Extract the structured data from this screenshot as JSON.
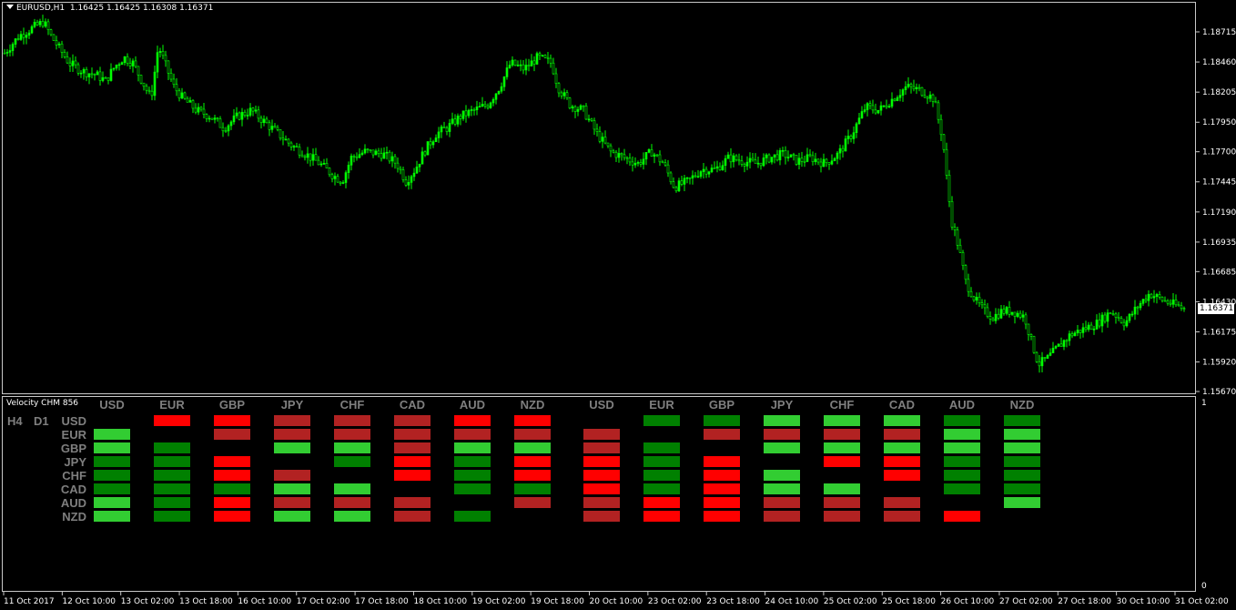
{
  "chart": {
    "symbol": "EURUSD,H1",
    "ohlc": "1.16425 1.16425 1.16308 1.16371",
    "current_price": "1.16371",
    "colors": {
      "background": "#000000",
      "candle": "#00ff00",
      "frame": "#c8c8c8",
      "text": "#ffffff"
    },
    "price_scale": [
      "1.18715",
      "1.18460",
      "1.18205",
      "1.17950",
      "1.17700",
      "1.17445",
      "1.17190",
      "1.16935",
      "1.16685",
      "1.16430",
      "1.16175",
      "1.15920",
      "1.15670"
    ],
    "time_scale": [
      "11 Oct 2017",
      "12 Oct 10:00",
      "13 Oct 02:00",
      "13 Oct 18:00",
      "16 Oct 10:00",
      "17 Oct 02:00",
      "17 Oct 18:00",
      "18 Oct 10:00",
      "19 Oct 02:00",
      "19 Oct 18:00",
      "20 Oct 10:00",
      "23 Oct 02:00",
      "23 Oct 18:00",
      "24 Oct 10:00",
      "25 Oct 02:00",
      "25 Oct 18:00",
      "26 Oct 10:00",
      "27 Oct 02:00",
      "27 Oct 18:00",
      "30 Oct 10:00",
      "31 Oct 02:00"
    ],
    "close_path": [
      [
        0,
        1.185
      ],
      [
        20,
        1.1868
      ],
      [
        35,
        1.1875
      ],
      [
        47,
        1.188
      ],
      [
        55,
        1.1868
      ],
      [
        75,
        1.1845
      ],
      [
        90,
        1.1838
      ],
      [
        105,
        1.1835
      ],
      [
        115,
        1.183
      ],
      [
        125,
        1.1842
      ],
      [
        135,
        1.185
      ],
      [
        145,
        1.1845
      ],
      [
        155,
        1.183
      ],
      [
        165,
        1.1815
      ],
      [
        173,
        1.186
      ],
      [
        180,
        1.1845
      ],
      [
        190,
        1.1825
      ],
      [
        200,
        1.1815
      ],
      [
        215,
        1.1805
      ],
      [
        230,
        1.18
      ],
      [
        245,
        1.179
      ],
      [
        260,
        1.18
      ],
      [
        275,
        1.1805
      ],
      [
        290,
        1.1795
      ],
      [
        305,
        1.1785
      ],
      [
        320,
        1.1775
      ],
      [
        335,
        1.1768
      ],
      [
        350,
        1.176
      ],
      [
        365,
        1.175
      ],
      [
        375,
        1.1745
      ],
      [
        385,
        1.1765
      ],
      [
        400,
        1.177
      ],
      [
        420,
        1.1768
      ],
      [
        435,
        1.176
      ],
      [
        445,
        1.1745
      ],
      [
        455,
        1.1755
      ],
      [
        465,
        1.177
      ],
      [
        478,
        1.1785
      ],
      [
        490,
        1.179
      ],
      [
        505,
        1.18
      ],
      [
        520,
        1.1805
      ],
      [
        535,
        1.181
      ],
      [
        548,
        1.1825
      ],
      [
        560,
        1.1845
      ],
      [
        575,
        1.184
      ],
      [
        590,
        1.185
      ],
      [
        605,
        1.1845
      ],
      [
        612,
        1.1825
      ],
      [
        625,
        1.181
      ],
      [
        640,
        1.1805
      ],
      [
        655,
        1.1785
      ],
      [
        670,
        1.177
      ],
      [
        685,
        1.1765
      ],
      [
        700,
        1.176
      ],
      [
        715,
        1.177
      ],
      [
        728,
        1.176
      ],
      [
        740,
        1.174
      ],
      [
        755,
        1.1745
      ],
      [
        770,
        1.1755
      ],
      [
        785,
        1.1755
      ],
      [
        800,
        1.1765
      ],
      [
        815,
        1.1762
      ],
      [
        830,
        1.176
      ],
      [
        845,
        1.1765
      ],
      [
        860,
        1.1768
      ],
      [
        875,
        1.1762
      ],
      [
        890,
        1.1765
      ],
      [
        905,
        1.176
      ],
      [
        920,
        1.1768
      ],
      [
        935,
        1.1785
      ],
      [
        950,
        1.1808
      ],
      [
        965,
        1.1805
      ],
      [
        980,
        1.1815
      ],
      [
        995,
        1.1825
      ],
      [
        1010,
        1.1822
      ],
      [
        1025,
        1.1815
      ],
      [
        1035,
        1.178
      ],
      [
        1040,
        1.174
      ],
      [
        1045,
        1.171
      ],
      [
        1052,
        1.169
      ],
      [
        1060,
        1.166
      ],
      [
        1070,
        1.1645
      ],
      [
        1080,
        1.1635
      ],
      [
        1090,
        1.163
      ],
      [
        1100,
        1.1635
      ],
      [
        1112,
        1.1635
      ],
      [
        1125,
        1.163
      ],
      [
        1132,
        1.161
      ],
      [
        1140,
        1.159
      ],
      [
        1150,
        1.1595
      ],
      [
        1162,
        1.1605
      ],
      [
        1175,
        1.1615
      ],
      [
        1190,
        1.162
      ],
      [
        1205,
        1.1625
      ],
      [
        1220,
        1.1635
      ],
      [
        1235,
        1.1625
      ],
      [
        1250,
        1.164
      ],
      [
        1262,
        1.165
      ],
      [
        1275,
        1.1645
      ],
      [
        1290,
        1.164
      ],
      [
        1300,
        1.1637
      ]
    ]
  },
  "indicator": {
    "name": "Velocity CHM 856",
    "scale_top": "1",
    "scale_bottom": "0",
    "timeframes": [
      "H4",
      "D1"
    ],
    "currencies": [
      "USD",
      "EUR",
      "GBP",
      "JPY",
      "CHF",
      "CAD",
      "AUD",
      "NZD"
    ],
    "colors": {
      "G": "#32cd32",
      "g": "#008000",
      "R": "#ff0000",
      "r": "#b22222",
      "header": "#7f7f7f"
    },
    "matrices": [
      {
        "timeframe": "H4",
        "rows": [
          [
            "-",
            "R",
            "R",
            "r",
            "r",
            "r",
            "R",
            "R"
          ],
          [
            "G",
            "-",
            "r",
            "r",
            "r",
            "r",
            "r",
            "r"
          ],
          [
            "G",
            "g",
            "-",
            "G",
            "G",
            "r",
            "G",
            "G"
          ],
          [
            "g",
            "g",
            "R",
            "-",
            "g",
            "R",
            "g",
            "R"
          ],
          [
            "g",
            "g",
            "R",
            "r",
            "-",
            "R",
            "g",
            "R"
          ],
          [
            "g",
            "g",
            "g",
            "G",
            "G",
            "-",
            "g",
            "g"
          ],
          [
            "G",
            "g",
            "R",
            "r",
            "r",
            "r",
            "-",
            "r"
          ],
          [
            "G",
            "g",
            "R",
            "G",
            "G",
            "r",
            "g",
            "-"
          ]
        ]
      },
      {
        "timeframe": "D1",
        "rows": [
          [
            "-",
            "g",
            "g",
            "G",
            "G",
            "G",
            "g",
            "g"
          ],
          [
            "r",
            "-",
            "r",
            "r",
            "r",
            "r",
            "G",
            "G"
          ],
          [
            "r",
            "g",
            "-",
            "G",
            "G",
            "G",
            "G",
            "G"
          ],
          [
            "R",
            "g",
            "R",
            "-",
            "R",
            "R",
            "g",
            "g"
          ],
          [
            "R",
            "g",
            "R",
            "G",
            "-",
            "R",
            "g",
            "g"
          ],
          [
            "R",
            "g",
            "R",
            "G",
            "G",
            "-",
            "g",
            "g"
          ],
          [
            "r",
            "R",
            "R",
            "r",
            "r",
            "r",
            "-",
            "G"
          ],
          [
            "r",
            "R",
            "R",
            "r",
            "r",
            "r",
            "R",
            "-"
          ]
        ]
      }
    ]
  }
}
